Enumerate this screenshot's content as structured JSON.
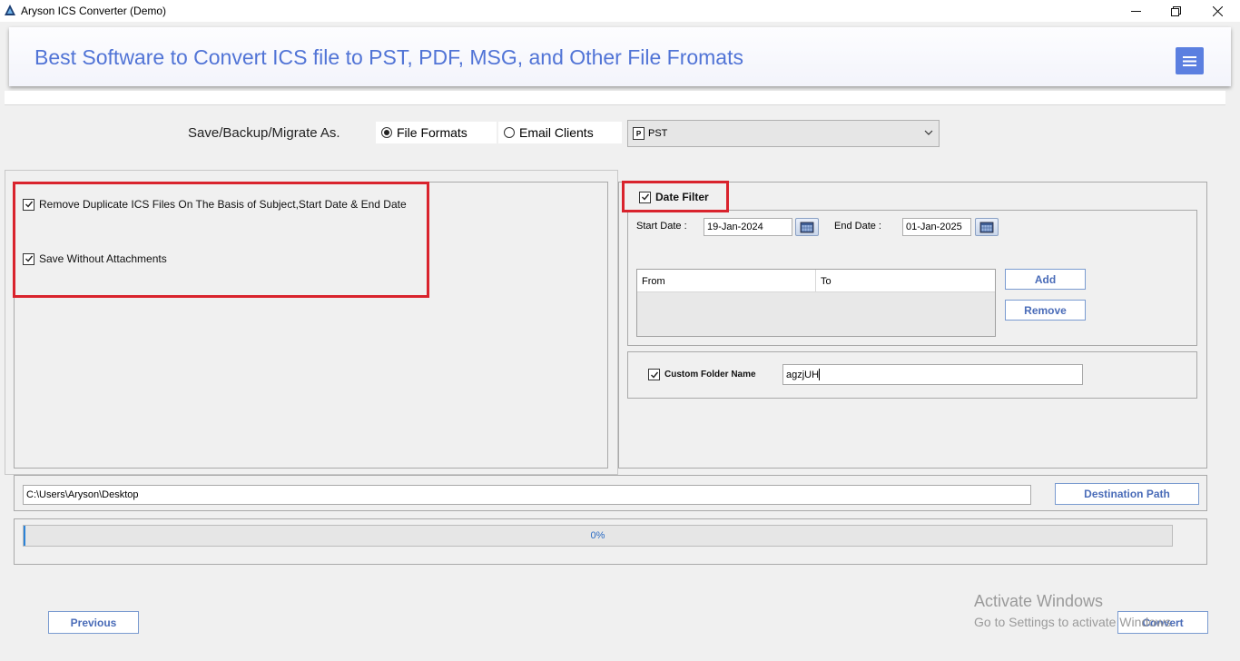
{
  "window": {
    "title": "Aryson ICS Converter (Demo)",
    "controls": {
      "minimize": "—",
      "restore": "❐",
      "close": "✕"
    }
  },
  "header": {
    "title": "Best Software to Convert ICS file to PST, PDF, MSG, and Other File Fromats",
    "menu_icon": "hamburger-icon",
    "accent_color": "#5174d6"
  },
  "save_as": {
    "label": "Save/Backup/Migrate As.",
    "options": [
      {
        "label": "File Formats",
        "selected": true
      },
      {
        "label": "Email Clients",
        "selected": false
      }
    ],
    "format_select": {
      "value": "PST",
      "icon": "pst-file-icon"
    }
  },
  "options_panel": {
    "remove_duplicates": {
      "label": "Remove Duplicate ICS Files On The Basis of Subject,Start Date & End Date",
      "checked": true
    },
    "save_without_attachments": {
      "label": "Save Without Attachments",
      "checked": true
    }
  },
  "date_filter": {
    "label": "Date Filter",
    "checked": true,
    "start_label": "Start Date :",
    "start_value": "19-Jan-2024",
    "end_label": "End Date :",
    "end_value": "01-Jan-2025",
    "table_columns": [
      "From",
      "To"
    ],
    "add_label": "Add",
    "remove_label": "Remove"
  },
  "custom_folder": {
    "label": "Custom Folder Name",
    "checked": true,
    "value": "agzjUH"
  },
  "destination": {
    "path": "C:\\Users\\Aryson\\Desktop",
    "button_label": "Destination Path"
  },
  "progress": {
    "percent": 0,
    "label": "0%"
  },
  "footer": {
    "previous_label": "Previous",
    "convert_label": "Convert"
  },
  "watermark": {
    "title": "Activate Windows",
    "subtitle": "Go to Settings to activate Windows."
  },
  "colors": {
    "highlight_red": "#d9232d",
    "button_text": "#4a6cb8"
  }
}
